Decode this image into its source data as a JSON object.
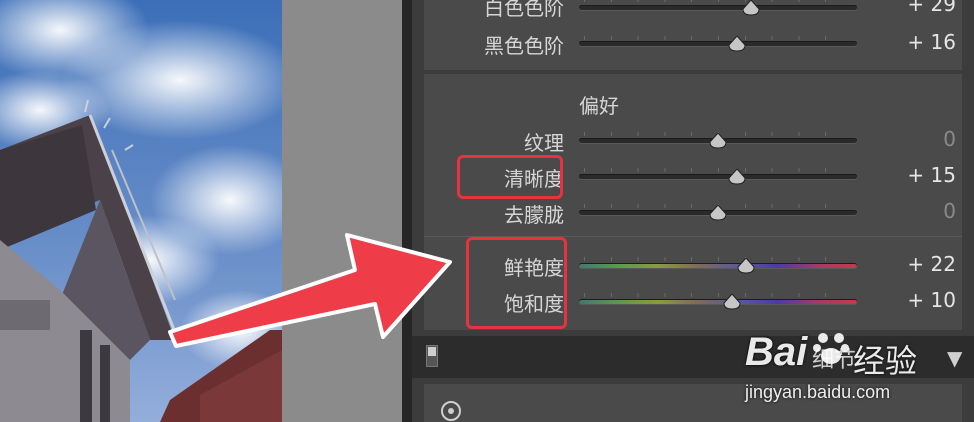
{
  "panel": {
    "tone_rows": [
      {
        "label": "白色色阶",
        "value": "+ 29",
        "level": 0.62
      },
      {
        "label": "黑色色阶",
        "value": "+ 16",
        "level": 0.57
      }
    ],
    "presence_heading": "偏好",
    "presence_rows": [
      {
        "label": "纹理",
        "value": "0",
        "level": 0.5
      },
      {
        "label": "清晰度",
        "value": "+ 15",
        "level": 0.57
      },
      {
        "label": "去朦胧",
        "value": "0",
        "level": 0.5
      }
    ],
    "color_rows": [
      {
        "label": "鲜艳度",
        "value": "+ 22",
        "level": 0.6
      },
      {
        "label": "饱和度",
        "value": "+ 10",
        "level": 0.55
      }
    ],
    "collapsed_section_label": "细节",
    "collapse_triangle": "▼"
  },
  "watermark": {
    "brand": "Bai",
    "brand_suffix": "经验",
    "url": "jingyan.baidu.com"
  },
  "colors": {
    "highlight": "#e8333f",
    "arrow": "#ee3d49"
  }
}
